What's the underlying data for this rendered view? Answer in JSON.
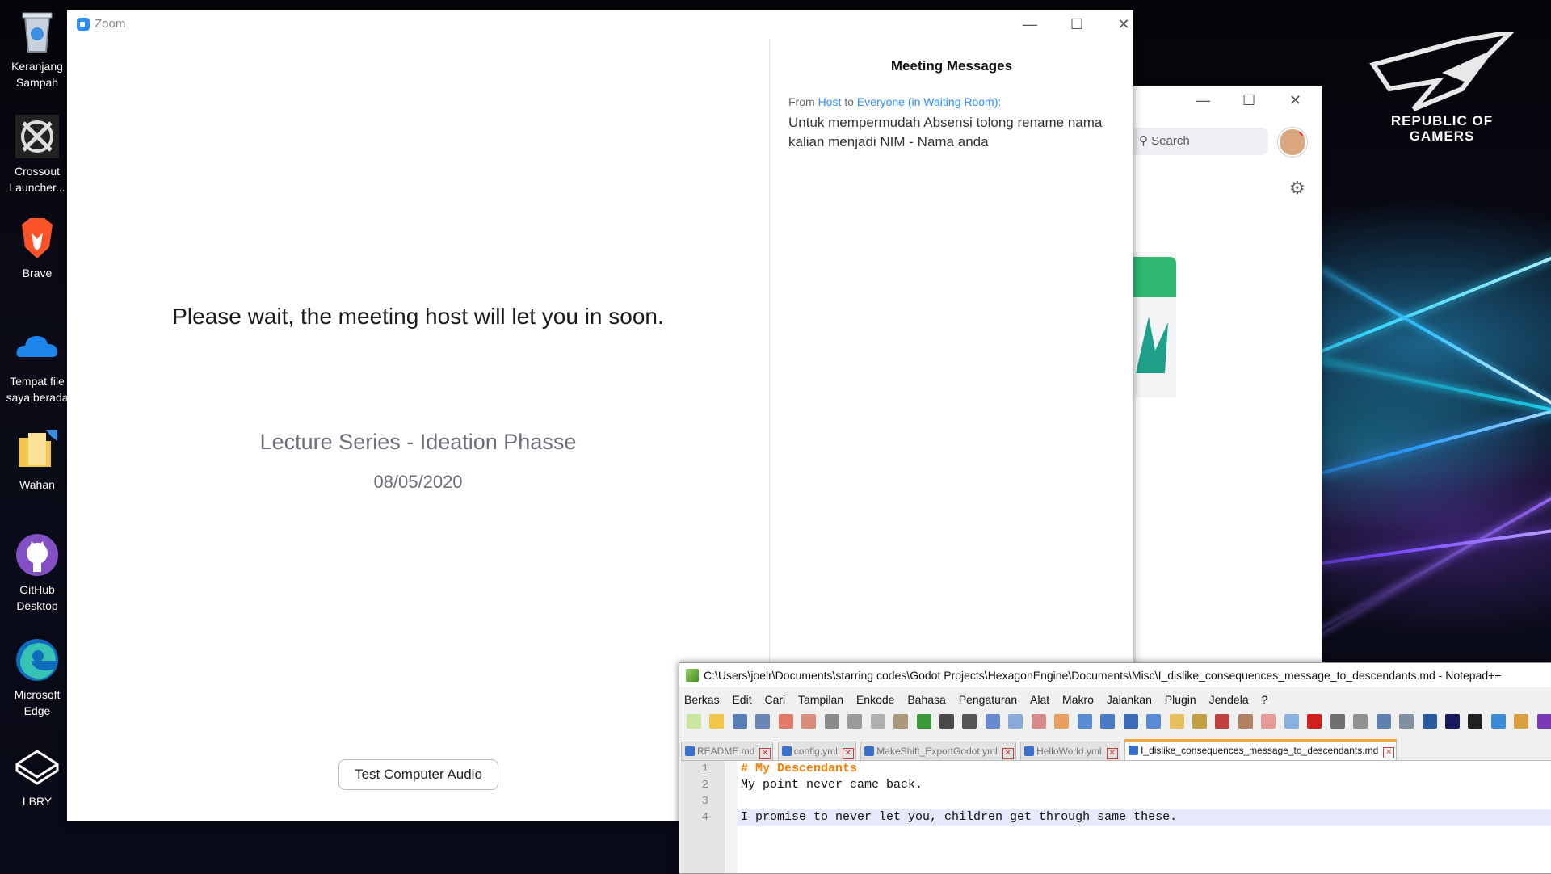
{
  "desktop": {
    "icons": [
      {
        "label": "Keranjang Sampah",
        "icon": "recycle-bin-icon"
      },
      {
        "label": "Crossout Launcher...",
        "icon": "crossout-icon"
      },
      {
        "label": "Brave",
        "icon": "brave-icon"
      },
      {
        "label": "Tempat file saya berada",
        "icon": "onedrive-icon"
      },
      {
        "label": "Wahan",
        "icon": "folder-shortcut-icon"
      },
      {
        "label": "GitHub Desktop",
        "icon": "github-desktop-icon"
      },
      {
        "label": "Microsoft Edge",
        "icon": "edge-icon"
      },
      {
        "label": "LBRY",
        "icon": "lbry-icon"
      }
    ],
    "wallpaper_brand": "REPUBLIC OF GAMERS"
  },
  "zoom_main": {
    "title": "Zoom",
    "wait_message": "Please wait, the meeting host will let you in soon.",
    "meeting_title": "Lecture Series - Ideation Phasse",
    "meeting_date": "08/05/2020",
    "test_audio_label": "Test Computer Audio",
    "messages_header": "Meeting Messages",
    "message": {
      "from_label": "From",
      "sender": "Host",
      "to_label": "to",
      "recipient": "Everyone (in Waiting Room):",
      "text": "Untuk mempermudah Absensi tolong rename nama kalian menjadi NIM - Nama anda"
    }
  },
  "zoom_background": {
    "search_placeholder": "Search"
  },
  "notepad": {
    "title": "C:\\Users\\joelr\\Documents\\starring codes\\Godot Projects\\HexagonEngine\\Documents\\Misc\\I_dislike_consequences_message_to_descendants.md - Notepad++",
    "menu": [
      "Berkas",
      "Edit",
      "Cari",
      "Tampilan",
      "Enkode",
      "Bahasa",
      "Pengaturan",
      "Alat",
      "Makro",
      "Jalankan",
      "Plugin",
      "Jendela",
      "?"
    ],
    "tabs": [
      {
        "label": "README.md",
        "active": false
      },
      {
        "label": "config.yml",
        "active": false
      },
      {
        "label": "MakeShift_ExportGodot.yml",
        "active": false
      },
      {
        "label": "HelloWorld.yml",
        "active": false
      },
      {
        "label": "I_dislike_consequences_message_to_descendants.md",
        "active": true
      }
    ],
    "lines": [
      {
        "num": "1",
        "text": "# My Descendants"
      },
      {
        "num": "2",
        "text": "My point never came back."
      },
      {
        "num": "3",
        "text": ""
      },
      {
        "num": "4",
        "text": "I promise to never let you, children get through same these."
      }
    ]
  }
}
